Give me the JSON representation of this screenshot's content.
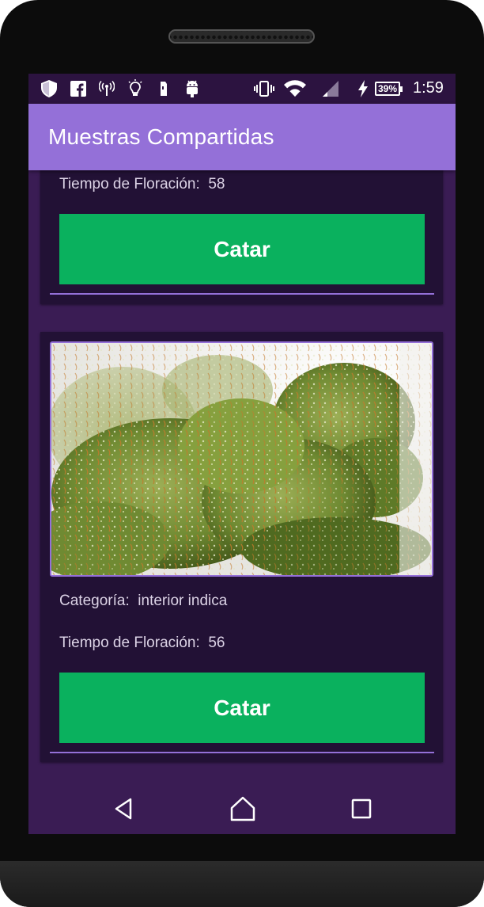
{
  "status_bar": {
    "icons": [
      "shield-icon",
      "facebook-icon",
      "hotspot-icon",
      "lightbulb-icon",
      "usb-icon",
      "android-debug-icon",
      "vibrate-icon",
      "wifi-icon",
      "signal-icon",
      "charging-icon"
    ],
    "battery": "39%",
    "time": "1:59"
  },
  "app_bar": {
    "title": "Muestras Compartidas"
  },
  "cards": [
    {
      "flowering_label": "Tiempo de Floración:",
      "flowering_value": "58",
      "button_label": "Catar"
    },
    {
      "image_icon": "cannabis-bud-photo",
      "category_label": "Categoría:",
      "category_value": "interior indica",
      "flowering_label": "Tiempo de Floración:",
      "flowering_value": "56",
      "button_label": "Catar"
    }
  ],
  "nav_bar": {
    "icons": [
      "back-icon",
      "home-icon",
      "recents-icon"
    ]
  },
  "colors": {
    "accent": "#9470d8",
    "button": "#0ab15e",
    "background": "#3a1c54",
    "card": "#221135"
  }
}
